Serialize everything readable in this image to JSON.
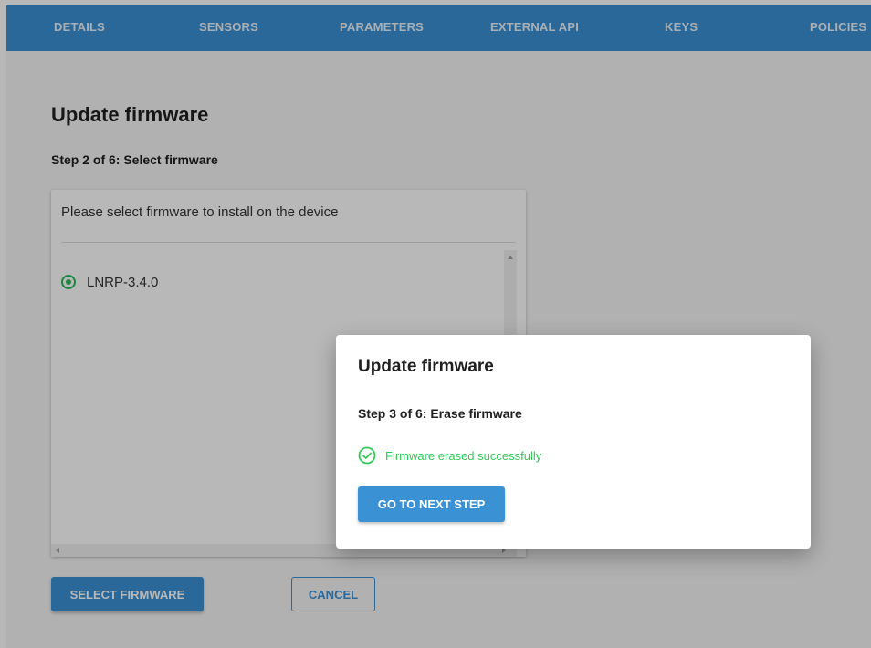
{
  "nav": {
    "tabs": [
      {
        "label": "DETAILS"
      },
      {
        "label": "SENSORS"
      },
      {
        "label": "PARAMETERS"
      },
      {
        "label": "EXTERNAL API"
      },
      {
        "label": "KEYS"
      },
      {
        "label": "POLICIES"
      }
    ]
  },
  "page": {
    "title": "Update firmware",
    "step": "Step 2 of 6: Select firmware",
    "card_text": "Please select firmware to install on the device",
    "firmware_options": [
      {
        "label": "LNRP-3.4.0",
        "selected": true
      }
    ],
    "select_button": "SELECT FIRMWARE",
    "cancel_button": "CANCEL"
  },
  "dialog": {
    "title": "Update firmware",
    "step": "Step 3 of 6: Erase firmware",
    "status_text": "Firmware erased successfully",
    "status_icon": "check-circle-icon",
    "next_button": "GO TO NEXT STEP"
  },
  "colors": {
    "primary": "#3a91d4",
    "success": "#34c759",
    "radio": "#2eb85c"
  }
}
